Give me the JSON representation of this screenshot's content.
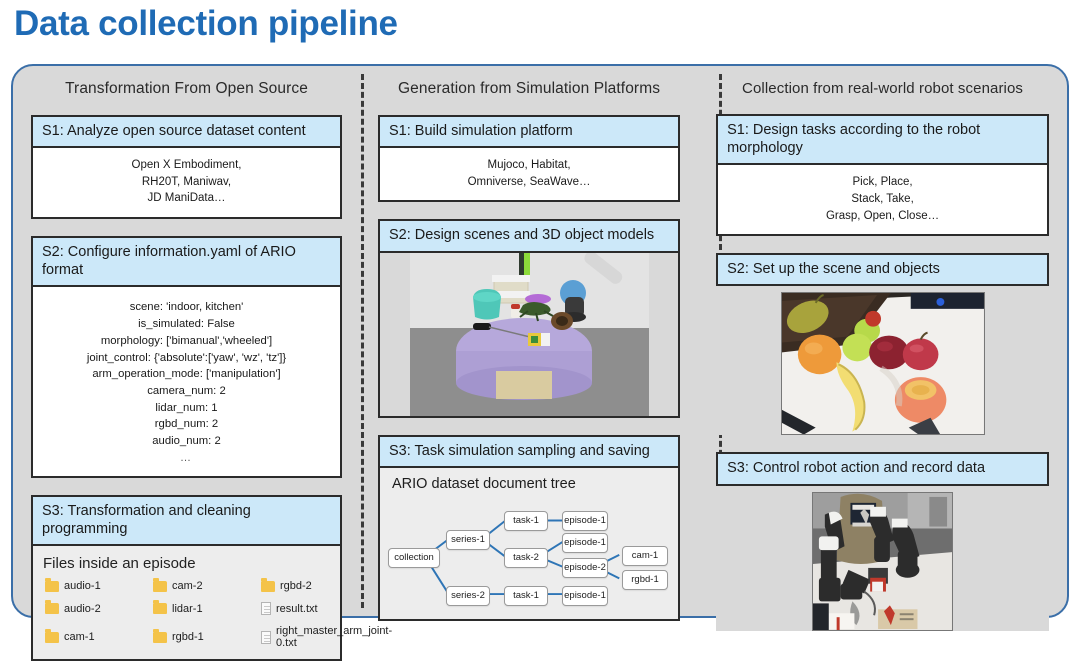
{
  "page_title": "Data collection pipeline",
  "theme": {
    "title_color": "#1F6BB5",
    "panel_bg": "#D9D9D9",
    "panel_border": "#3B6FA8",
    "step_header_bg": "#CCE8F9",
    "folder_icon_color": "#F4C349"
  },
  "columns": [
    {
      "header": "Transformation From Open Source",
      "steps": [
        {
          "title": "S1: Analyze open source dataset content",
          "body_lines": [
            "Open X Embodiment,",
            "RH20T, Maniwav,",
            "JD ManiData…"
          ]
        },
        {
          "title": "S2: Configure information.yaml of ARIO format",
          "body_lines": [
            "scene: 'indoor, kitchen'",
            "is_simulated: False",
            "morphology: ['bimanual','wheeled']",
            "joint_control: {'absolute':['yaw', 'wz', 'tz']}",
            "arm_operation_mode: ['manipulation']",
            "camera_num: 2",
            "lidar_num: 1",
            "rgbd_num: 2",
            "audio_num: 2",
            "…"
          ]
        },
        {
          "title": "S3: Transformation and cleaning programming",
          "files_caption": "Files inside an episode",
          "files": [
            {
              "name": "audio-1",
              "icon": "folder-icon"
            },
            {
              "name": "cam-2",
              "icon": "folder-icon"
            },
            {
              "name": "rgbd-2",
              "icon": "folder-icon"
            },
            {
              "name": "audio-2",
              "icon": "folder-icon"
            },
            {
              "name": "lidar-1",
              "icon": "folder-icon"
            },
            {
              "name": "result.txt",
              "icon": "document-icon"
            },
            {
              "name": "cam-1",
              "icon": "folder-icon"
            },
            {
              "name": "rgbd-1",
              "icon": "folder-icon"
            },
            {
              "name": "right_master_arm_joint-0.txt",
              "icon": "document-icon"
            }
          ]
        }
      ]
    },
    {
      "header": "Generation from Simulation Platforms",
      "steps": [
        {
          "title": "S1: Build simulation platform",
          "body_lines": [
            "Mujoco, Habitat,",
            "Omniverse, SeaWave…"
          ]
        },
        {
          "title": "S2: Design scenes and 3D object models",
          "image_caption": "simulated-tabletop-scene"
        },
        {
          "title": "S3: Task simulation sampling and saving",
          "tree_caption": "ARIO dataset document tree",
          "tree_nodes": [
            "collection",
            "series-1",
            "series-2",
            "task-1",
            "task-2",
            "task-1",
            "episode-1",
            "episode-1",
            "episode-2",
            "episode-1",
            "cam-1",
            "rgbd-1"
          ]
        }
      ]
    },
    {
      "header": "Collection from real-world robot scenarios",
      "steps": [
        {
          "title": "S1: Design tasks according to the robot morphology",
          "body_lines": [
            "Pick, Place,",
            "Stack, Take,",
            "Grasp, Open, Close…"
          ]
        },
        {
          "title": "S2: Set up the scene and objects",
          "image_caption": "fruits-on-table-photo"
        },
        {
          "title": "S3: Control robot action and record data",
          "image_caption": "teleoperation-robot-arms-photo"
        }
      ]
    }
  ]
}
